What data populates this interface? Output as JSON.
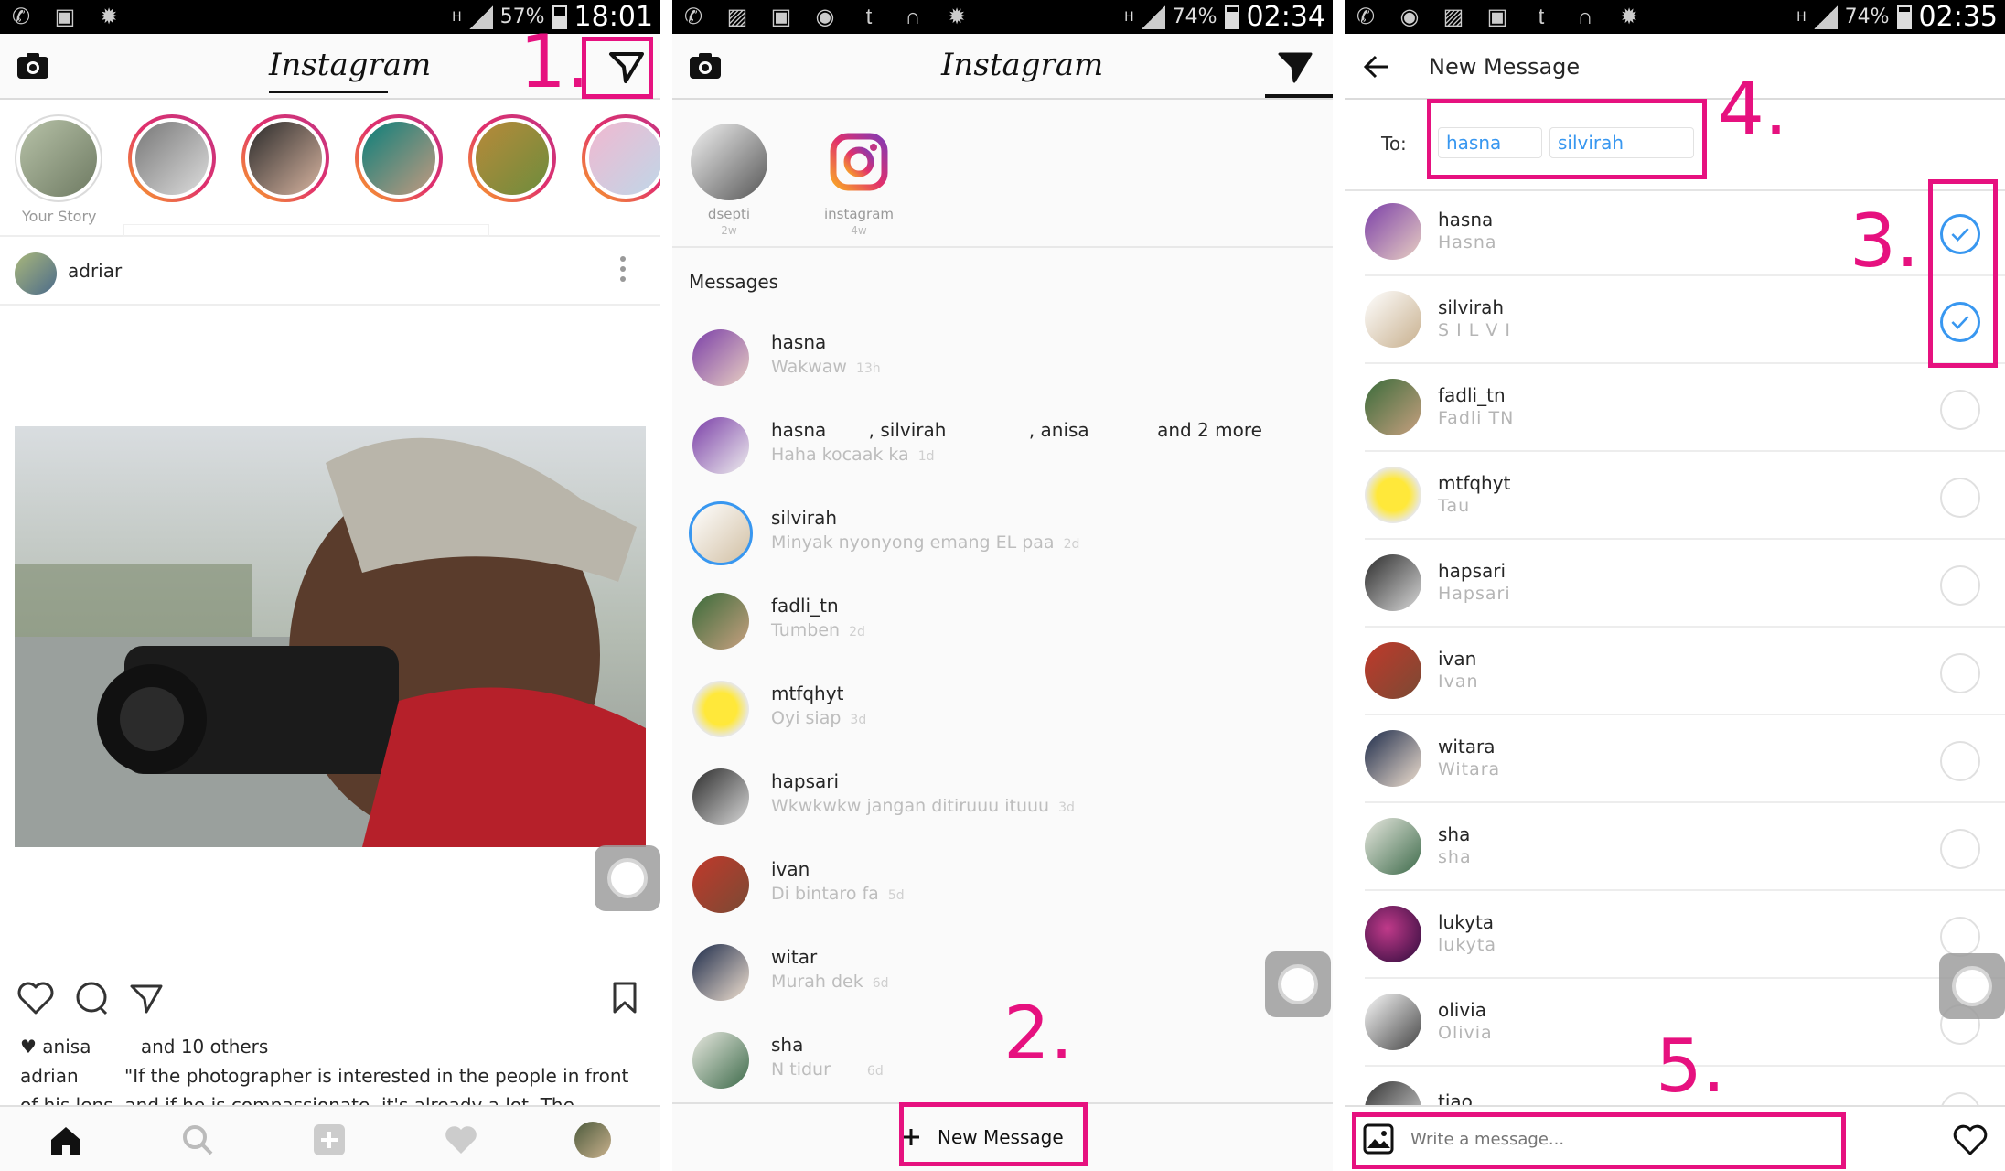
{
  "panel1": {
    "status": {
      "battery": "57%",
      "time": "18:01",
      "net": "H"
    },
    "title": "Instagram",
    "step": "1.",
    "stories": {
      "your_story": "Your Story"
    },
    "post": {
      "username": "adriar",
      "liked_by": "anisa",
      "liked_others": "and 10 others",
      "caption_user": "adrian",
      "caption_text": "\"If the photographer is interested in the people in front of his lens, and if he is compassionate, it's already a lot. The instrument is not"
    }
  },
  "panel2": {
    "status": {
      "battery": "74%",
      "time": "02:34",
      "net": "H"
    },
    "title": "Instagram",
    "stories": [
      {
        "name": "dsepti",
        "age": "2w"
      },
      {
        "name": "instagram",
        "age": "4w"
      }
    ],
    "section": "Messages",
    "threads": [
      {
        "name": "hasna",
        "preview": "Wakwaw",
        "time": "13h"
      },
      {
        "name": "hasna",
        "name2": ", silvirah",
        "name3": ", anisa",
        "more": "and 2 more",
        "preview": "Haha kocaak ka",
        "time": "1d"
      },
      {
        "name": "silvirah",
        "preview": "Minyak nyonyong emang EL paa",
        "time": "2d"
      },
      {
        "name": "fadli_tn",
        "preview": "Tumben",
        "time": "2d"
      },
      {
        "name": "mtfqhyt",
        "preview": "Oyi siap",
        "time": "3d"
      },
      {
        "name": "hapsari",
        "preview": "Wkwkwkw jangan ditiruuu ituuu",
        "time": "3d"
      },
      {
        "name": "ivan",
        "preview": "Di bintaro fa",
        "time": "5d"
      },
      {
        "name": "witar",
        "preview": "Murah dek",
        "time": "6d"
      },
      {
        "name": "sha",
        "preview": "N     tidur",
        "time": "6d"
      }
    ],
    "step": "2.",
    "new_message": "New Message"
  },
  "panel3": {
    "status": {
      "battery": "74%",
      "time": "02:35",
      "net": "H"
    },
    "title": "New Message",
    "to_label": "To:",
    "chips": [
      "hasna",
      "silvirah"
    ],
    "step3": "3.",
    "step4": "4.",
    "step5": "5.",
    "contacts": [
      {
        "user": "hasna",
        "full": "Hasna",
        "selected": true
      },
      {
        "user": "silvirah",
        "full": "S I L V I",
        "selected": true
      },
      {
        "user": "fadli_tn",
        "full": "Fadli TN",
        "selected": false
      },
      {
        "user": "mtfqhyt",
        "full": "Tau",
        "selected": false
      },
      {
        "user": "hapsari",
        "full": "Hapsari",
        "selected": false
      },
      {
        "user": "ivan",
        "full": "Ivan",
        "selected": false
      },
      {
        "user": "witara",
        "full": "Witara",
        "selected": false
      },
      {
        "user": "sha",
        "full": "sha",
        "selected": false
      },
      {
        "user": "lukyta",
        "full": "lukyta",
        "selected": false
      },
      {
        "user": "olivia",
        "full": "Olivia",
        "selected": false
      },
      {
        "user": "tiao",
        "full": "",
        "selected": false
      }
    ],
    "compose_placeholder": "Write a message..."
  },
  "colors": {
    "annotation": "#e6117f",
    "accent": "#3897f0"
  }
}
